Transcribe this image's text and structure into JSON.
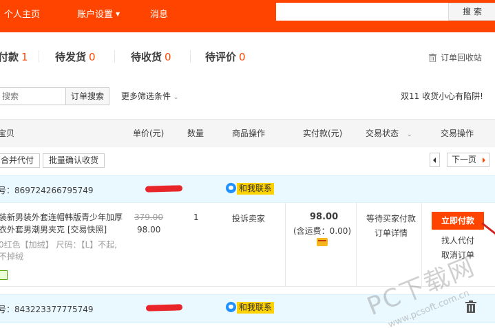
{
  "topbar": {
    "nav": [
      "个人主页",
      "账户设置",
      "消息"
    ],
    "search_value": "",
    "search_button": "搜索"
  },
  "tabs": [
    {
      "label": "付款",
      "count": "1"
    },
    {
      "label": "待发货",
      "count": "0"
    },
    {
      "label": "待收货",
      "count": "0"
    },
    {
      "label": "待评价",
      "count": "0"
    }
  ],
  "recycle_label": "订单回收站",
  "filters": {
    "order_search_placeholder": "搜索",
    "order_search_button": "订单搜索",
    "more_filters": "更多筛选条件",
    "notice": "双11 收货小心有陷阱!"
  },
  "columns": [
    "宝贝",
    "单价(元)",
    "数量",
    "商品操作",
    "实付款(元)",
    "交易状态",
    "交易操作"
  ],
  "batch": {
    "merge_pay": "合并代付",
    "batch_confirm": "批量确认收货",
    "next_page": "下一页"
  },
  "orders": [
    {
      "order_no": "号：869724266795749",
      "contact_label": "和我联系",
      "title": "装新男装外套连帽韩版青少年加厚衣外套男潮男夹克 [交易快照]",
      "sku": "0红色【加绒】 尺码：【L】不起,不掉绒",
      "original_price": "379.00",
      "price": "98.00",
      "quantity": "1",
      "item_action": "投诉卖家",
      "paid": "98.00",
      "shipping": "(含运费：0.00)",
      "status": "等待买家付款",
      "details": "订单详情",
      "pay_button": "立即付款",
      "friend_pay": "找人代付",
      "cancel": "取消订单"
    },
    {
      "order_no": "号：843223377775749",
      "contact_label": "和我联系"
    }
  ],
  "watermark": {
    "big": "PC下载网",
    "small": "www.pcsoft.com.cn"
  }
}
